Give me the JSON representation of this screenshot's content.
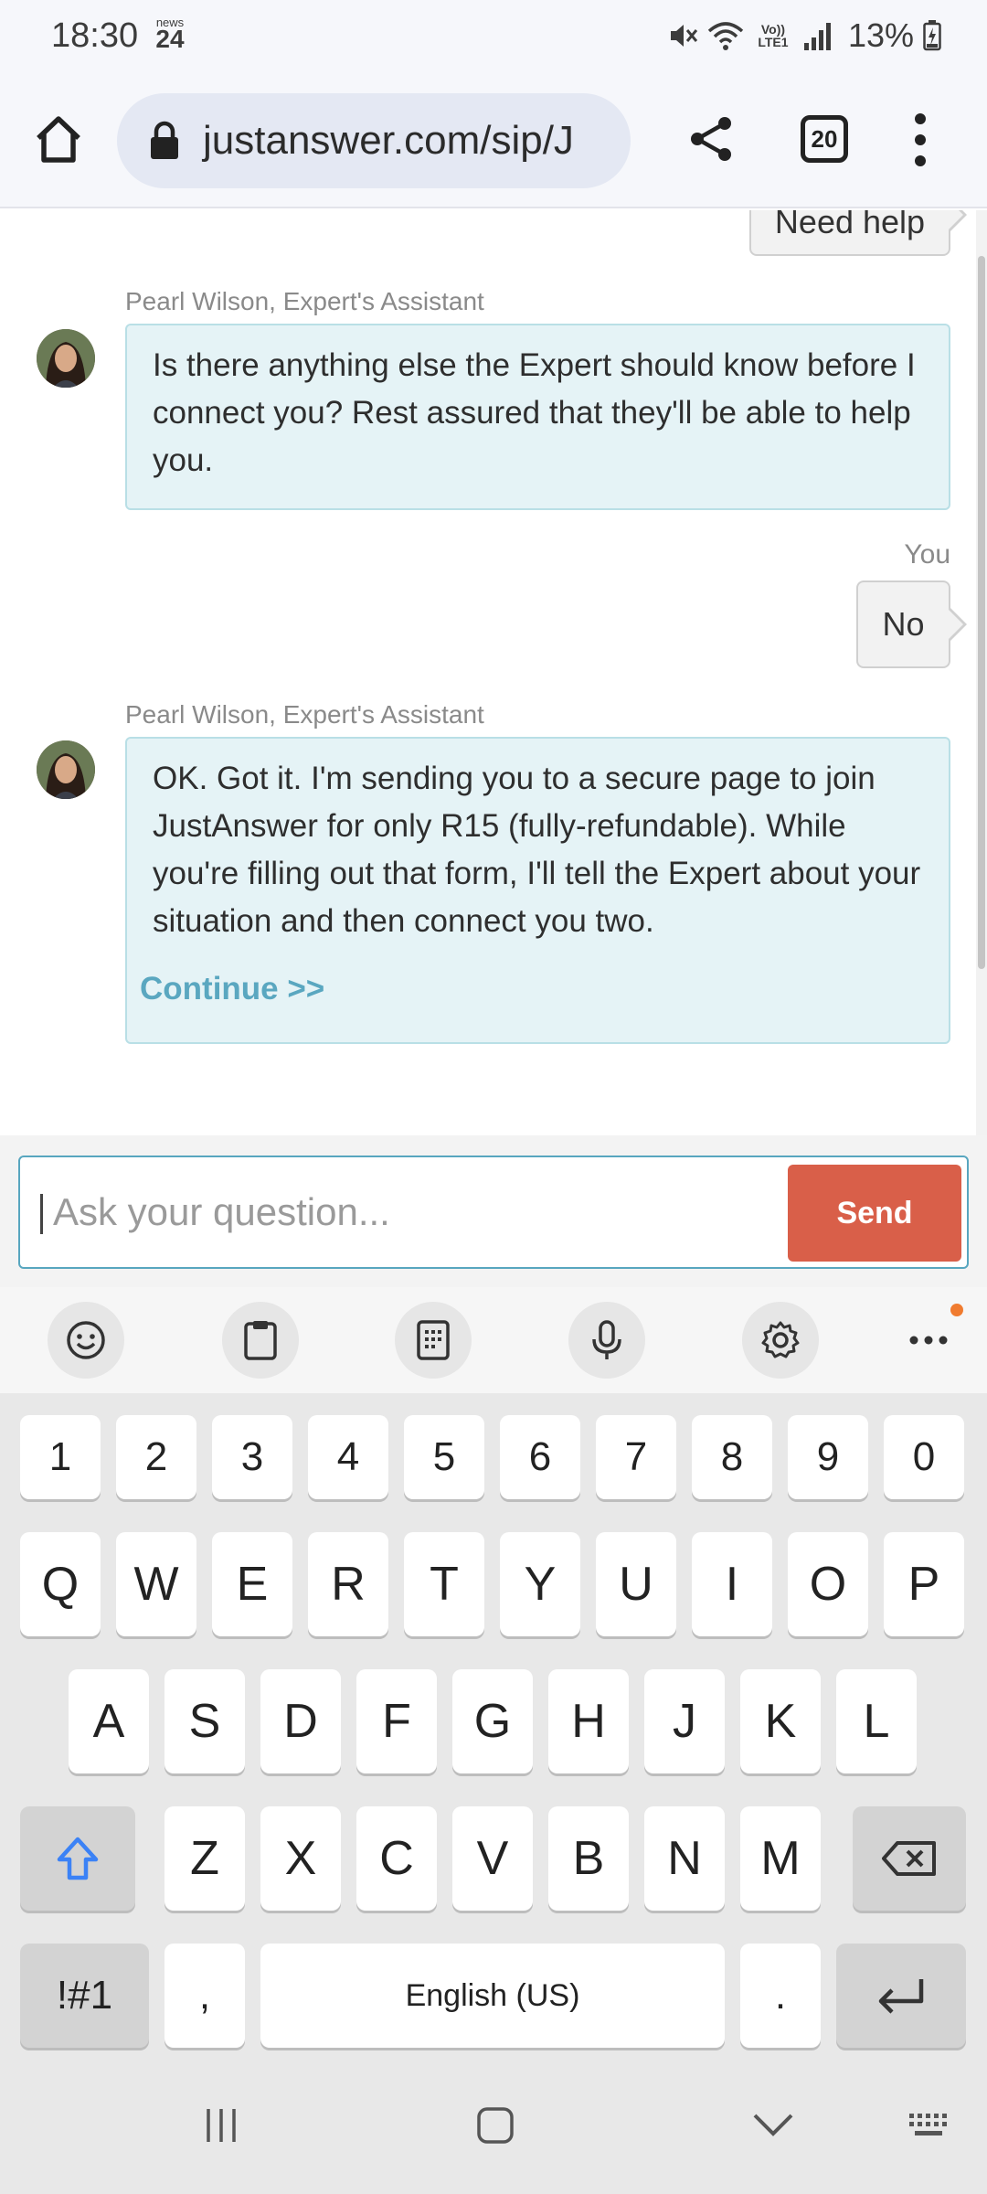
{
  "status_bar": {
    "time": "18:30",
    "news_top": "news",
    "news_bottom": "24",
    "network": "Vo)) LTE1",
    "battery": "13%"
  },
  "browser": {
    "url": "justanswer.com/sip/J",
    "tab_count": "20"
  },
  "chat": {
    "partial_user_message": "Need help",
    "messages": [
      {
        "sender": "Pearl Wilson, Expert's Assistant",
        "text": "Is there anything else the Expert should know before I connect you? Rest assured that they'll be able to help you."
      },
      {
        "sender": "You",
        "text": "No"
      },
      {
        "sender": "Pearl Wilson, Expert's Assistant",
        "text": "OK. Got it. I'm sending you to a secure page to join JustAnswer for only R15 (fully-refundable). While you're filling out that form, I'll tell the Expert about your situation and then connect you two.",
        "link": "Continue >>"
      }
    ]
  },
  "composer": {
    "placeholder": "Ask your question...",
    "send_label": "Send"
  },
  "keyboard": {
    "numbers": [
      "1",
      "2",
      "3",
      "4",
      "5",
      "6",
      "7",
      "8",
      "9",
      "0"
    ],
    "row1": [
      "Q",
      "W",
      "E",
      "R",
      "T",
      "Y",
      "U",
      "I",
      "O",
      "P"
    ],
    "row2": [
      "A",
      "S",
      "D",
      "F",
      "G",
      "H",
      "J",
      "K",
      "L"
    ],
    "row3": [
      "Z",
      "X",
      "C",
      "V",
      "B",
      "N",
      "M"
    ],
    "symbols_key": "!#1",
    "comma_key": ",",
    "space_label": "English (US)",
    "period_key": "."
  },
  "colors": {
    "accent": "#58a6bf",
    "send": "#d95f49",
    "bot_bubble": "#e5f3f6",
    "link": "#5aa7c0"
  }
}
